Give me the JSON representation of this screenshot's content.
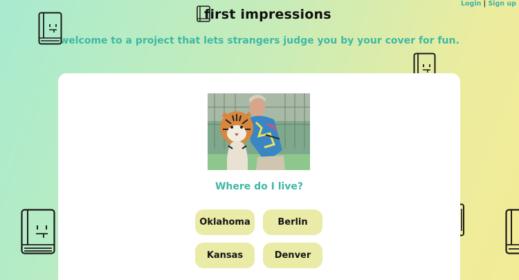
{
  "header": {
    "title": "first impressions",
    "tagline": "welcome to a project that lets strangers judge you by your cover for fun."
  },
  "auth": {
    "login_label": "Login",
    "separator": "|",
    "signup_label": "Sign up"
  },
  "quiz": {
    "question": "Where do I live?",
    "answers": [
      "Oklahoma",
      "Berlin",
      "Kansas",
      "Denver"
    ]
  },
  "colors": {
    "accent": "#3fb8a4",
    "answer_bg": "#eaeba6",
    "card_bg": "#ffffff"
  },
  "icons": {
    "decorations": "book-face-icon",
    "photo": "person-with-tiger-photo"
  }
}
